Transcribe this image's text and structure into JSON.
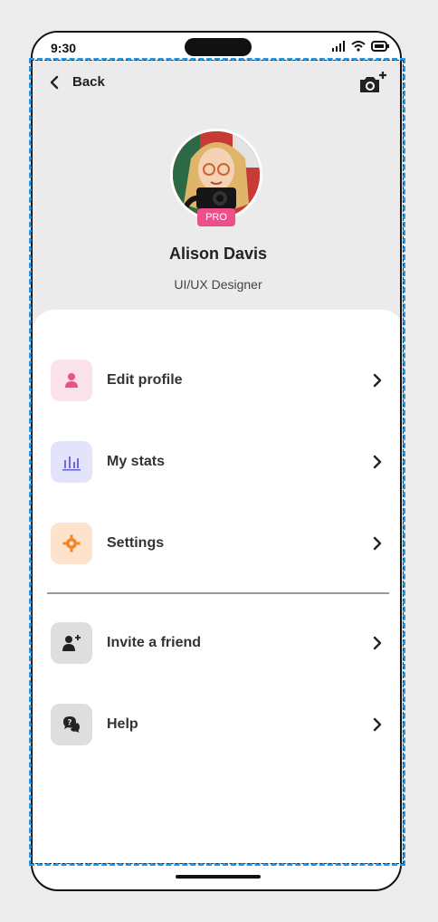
{
  "status": {
    "time": "9:30"
  },
  "header": {
    "back_label": "Back"
  },
  "profile": {
    "name": "Alison Davis",
    "role": "UI/UX Designer",
    "badge": "PRO"
  },
  "menu": [
    {
      "label": "Edit profile",
      "icon": "person-icon",
      "bg": "#fbe1ea",
      "fg": "#ec4f8a"
    },
    {
      "label": "My stats",
      "icon": "bar-chart-icon",
      "bg": "#e3e3fb",
      "fg": "#6b6bdf"
    },
    {
      "label": "Settings",
      "icon": "gear-icon",
      "bg": "#fde3cc",
      "fg": "#f28527"
    },
    {
      "label": "Invite a friend",
      "icon": "add-person-icon",
      "bg": "#dedede",
      "fg": "#222"
    },
    {
      "label": "Help",
      "icon": "help-chat-icon",
      "bg": "#dedede",
      "fg": "#222"
    }
  ],
  "colors": {
    "accent_blue": "#1b9cf2",
    "pro_pink": "#ec4f8a"
  }
}
